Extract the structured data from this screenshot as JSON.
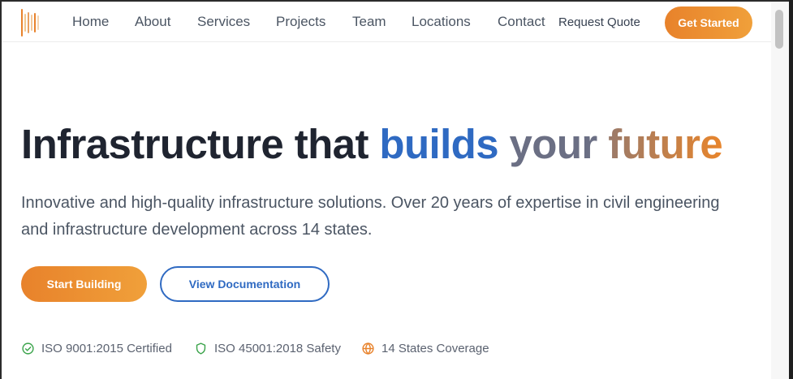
{
  "header": {
    "nav": [
      "Home",
      "About",
      "Services",
      "Projects",
      "Team",
      "Locations",
      "Contact"
    ],
    "request_quote": "Request Quote",
    "cta": "Get Started"
  },
  "hero": {
    "title_main": "Infrastructure that ",
    "title_w1": "builds",
    "title_w2": "your",
    "title_w3": "future",
    "subtitle": "Innovative and high-quality infrastructure solutions. Over 20 years of expertise in civil engineering and infrastructure development across 14 states.",
    "primary_button": "Start Building",
    "secondary_button": "View Documentation"
  },
  "badges": [
    {
      "icon": "check-circle-icon",
      "label": "ISO 9001:2015 Certified"
    },
    {
      "icon": "shield-icon",
      "label": "ISO 45001:2018 Safety"
    },
    {
      "icon": "globe-icon",
      "label": "14 States Coverage"
    }
  ],
  "colors": {
    "accent_orange": "#e8822b",
    "accent_blue": "#2f6ac2",
    "text_dark": "#1f2430"
  }
}
